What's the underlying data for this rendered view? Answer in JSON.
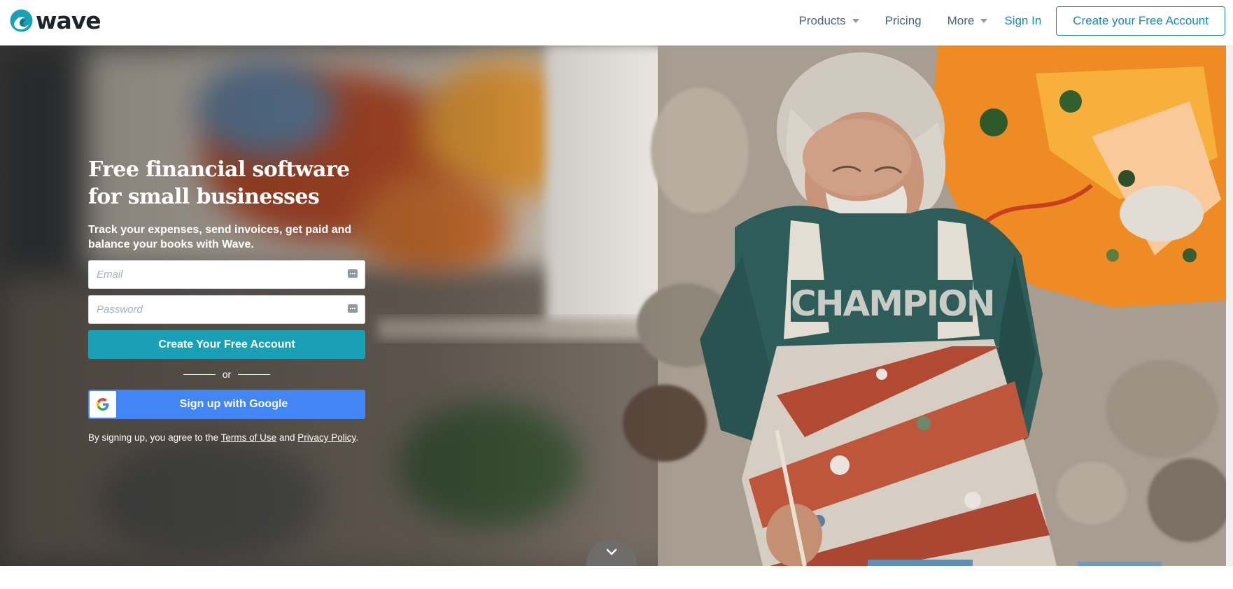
{
  "brand": {
    "name": "wave",
    "accent": "#1aa0b6",
    "link_blue": "#1a86b5",
    "google_blue": "#4285f4"
  },
  "nav": {
    "products_label": "Products",
    "pricing_label": "Pricing",
    "more_label": "More",
    "signin_label": "Sign In",
    "cta_label": "Create your Free Account"
  },
  "hero": {
    "headline": "Free financial software for small businesses",
    "subline": "Track your expenses, send invoices, get paid and balance your books with Wave.",
    "email_placeholder": "Email",
    "password_placeholder": "Password",
    "create_button": "Create Your Free Account",
    "divider_text": "or",
    "google_button": "Sign up with Google",
    "legal_prefix": "By signing up, you agree to the",
    "terms_link": "Terms of Use",
    "legal_and": "and",
    "privacy_link": "Privacy Policy",
    "legal_suffix": "."
  },
  "icons": {
    "logo": "wave-logo-icon",
    "caret": "caret-down-icon",
    "password_manager": "key-icon",
    "google": "google-g-icon",
    "scroll": "chevron-down-icon"
  }
}
